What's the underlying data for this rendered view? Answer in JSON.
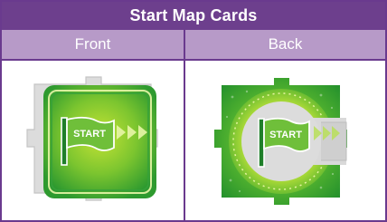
{
  "table": {
    "title": "Start Map Cards",
    "columns": [
      "Front",
      "Back"
    ]
  },
  "cards": {
    "front_flag_text": "START",
    "back_flag_text": "START"
  },
  "colors": {
    "header": "#6d3f8d",
    "subheader": "#b79ac8",
    "border": "#6a3a8e",
    "green": "#5cb82e",
    "light_green": "#a6d72a",
    "dark_green": "#1f8a2a",
    "grey": "#d6d6d6"
  }
}
